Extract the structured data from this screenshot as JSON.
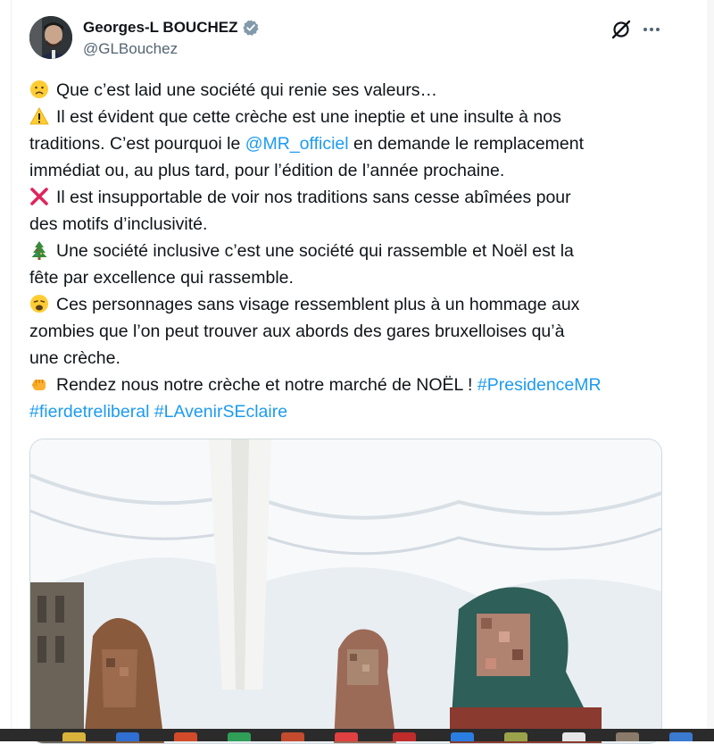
{
  "author": {
    "display_name": "Georges-L BOUCHEZ",
    "handle": "@GLBouchez"
  },
  "icons": {
    "verified": "verified-badge-icon",
    "grok": "grok-icon",
    "more": "more-options-icon"
  },
  "colors": {
    "link": "#1d9bf0",
    "text": "#0f1419",
    "muted": "#536471"
  },
  "post": {
    "line1": "Que c’est laid une société qui renie ses valeurs…",
    "line2": "Il est évident que cette crèche est une ineptie et une insulte à nos",
    "line3_a": "traditions. C’est pourquoi le ",
    "line3_mention": "@MR_officiel",
    "line3_b": " en demande le remplacement",
    "line4": "immédiat ou, au plus tard, pour l’édition de l’année prochaine.",
    "line5": "Il est insupportable de voir nos traditions sans cesse abîmées pour",
    "line6": "des motifs d’inclusivité.",
    "line7": "Une société inclusive c’est une société qui rassemble et Noël est la",
    "line8": "fête par excellence qui rassemble.",
    "line9": "Ces personnages sans visage ressemblent plus à un hommage aux",
    "line10": "zombies que l’on peut trouver aux abords des gares bruxelloises qu’à",
    "line11": "une crèche.",
    "line12_a": "Rendez nous notre crèche et notre marché de NOËL ! ",
    "hashtag1": "#PresidenceMR",
    "hashtag2": "#fierdetreliberal",
    "hashtag3": "#LAvenirSEclaire"
  },
  "emojis": [
    "frowning-face-icon",
    "warning-icon",
    "cross-mark-icon",
    "christmas-tree-icon",
    "weary-face-icon",
    "raised-fist-icon"
  ],
  "media": {
    "description_icon": "nativity-photo-image"
  }
}
